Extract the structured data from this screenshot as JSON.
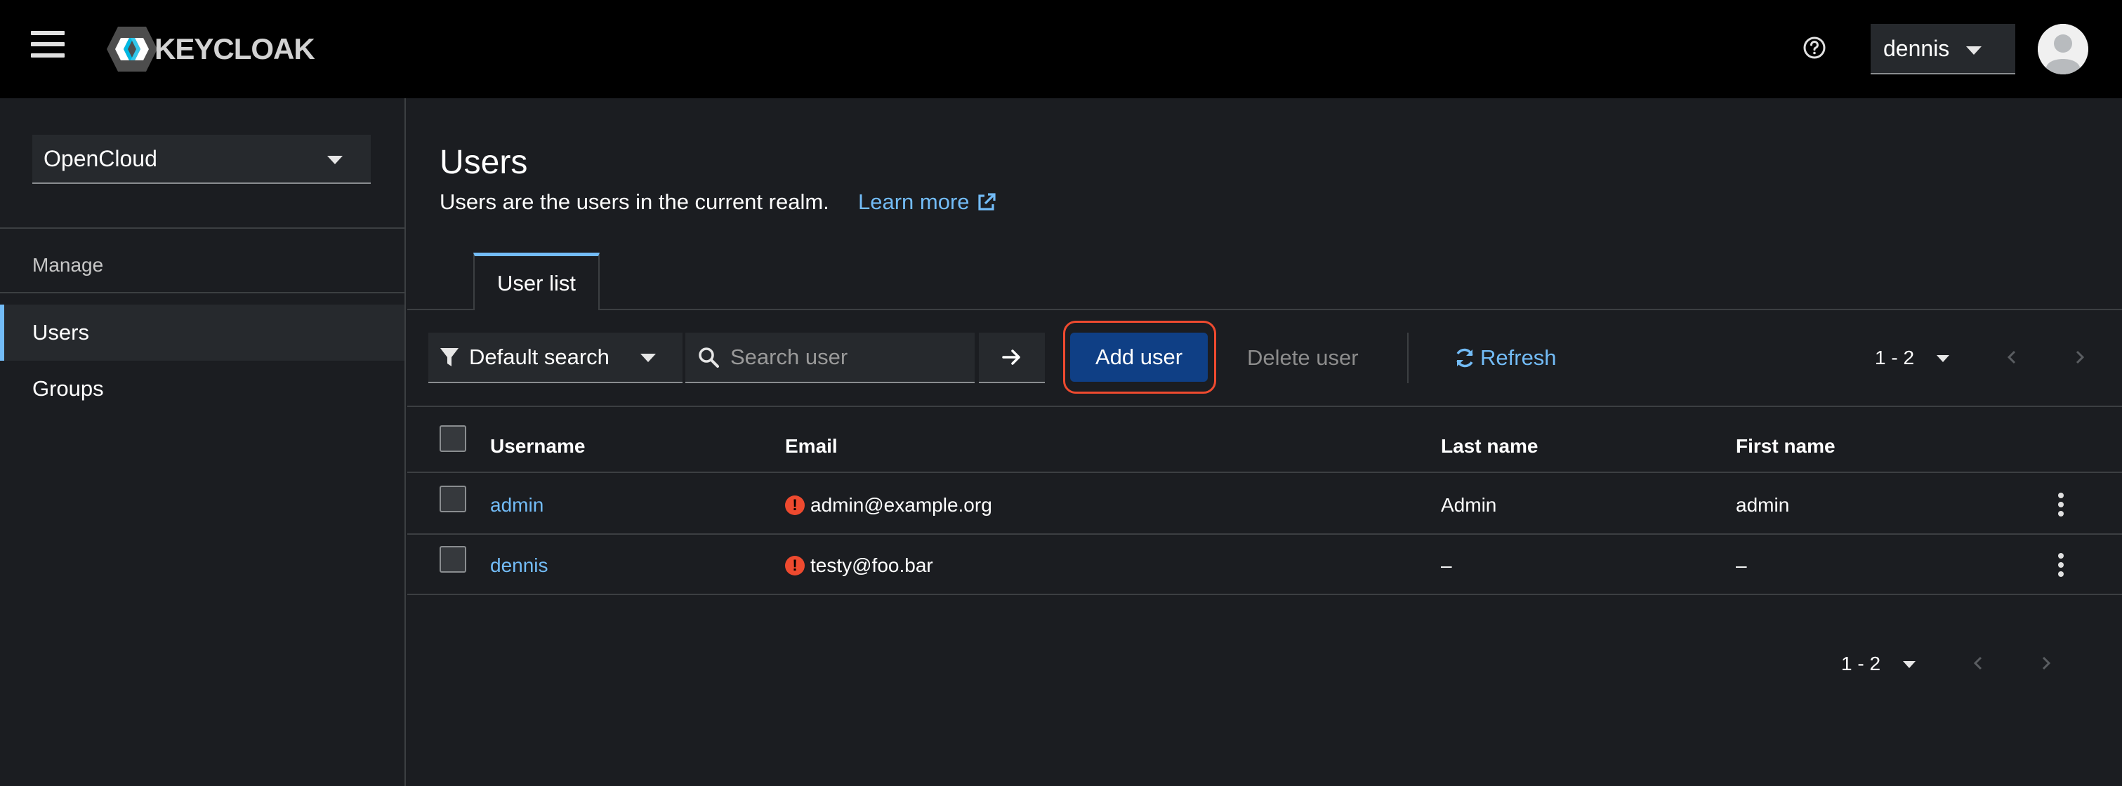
{
  "header": {
    "logo_text": "KEYCLOAK",
    "user_name": "dennis"
  },
  "sidebar": {
    "realm": "OpenCloud",
    "section_title": "Manage",
    "items": [
      {
        "label": "Users",
        "active": true
      },
      {
        "label": "Groups",
        "active": false
      }
    ]
  },
  "page": {
    "title": "Users",
    "description": "Users are the users in the current realm.",
    "learn_more": "Learn more"
  },
  "tabs": [
    {
      "label": "User list"
    }
  ],
  "toolbar": {
    "search_type": "Default search",
    "search_placeholder": "Search user",
    "add_user": "Add user",
    "delete_user": "Delete user",
    "refresh": "Refresh",
    "pagination": "1 - 2"
  },
  "table": {
    "columns": [
      "Username",
      "Email",
      "Last name",
      "First name"
    ],
    "rows": [
      {
        "username": "admin",
        "email": "admin@example.org",
        "last_name": "Admin",
        "first_name": "admin"
      },
      {
        "username": "dennis",
        "email": "testy@foo.bar",
        "last_name": "–",
        "first_name": "–"
      }
    ]
  },
  "footer_pagination": "1 - 2",
  "colors": {
    "accent": "#73bcf7",
    "primary_button": "#0f3f85",
    "highlight": "#ee4a2f",
    "background": "#1b1d21",
    "masthead": "#000000"
  }
}
